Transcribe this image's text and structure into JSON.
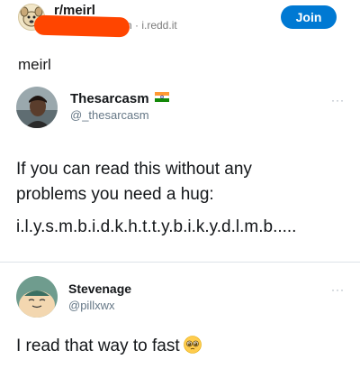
{
  "post": {
    "subreddit": "r/meirl",
    "meta": "h · i.redd.it",
    "join_label": "Join",
    "title": "meirl"
  },
  "tweets": [
    {
      "name": "Thesarcasm",
      "handle": "@_thesarcasm",
      "text_lines": [
        "If you can read this without any",
        "problems you need a hug:",
        "i.l.y.s.m.b.i.d.k.h.t.t.y.b.i.k.y.d.l.m.b....."
      ],
      "more": "···"
    },
    {
      "name": "Stevenage",
      "handle": "@pillxwx",
      "text": "I read that way to fast",
      "emoji": "pleading-face-icon",
      "more": "···"
    }
  ],
  "colors": {
    "join": "#0079d3",
    "redaction": "#ff4500"
  }
}
